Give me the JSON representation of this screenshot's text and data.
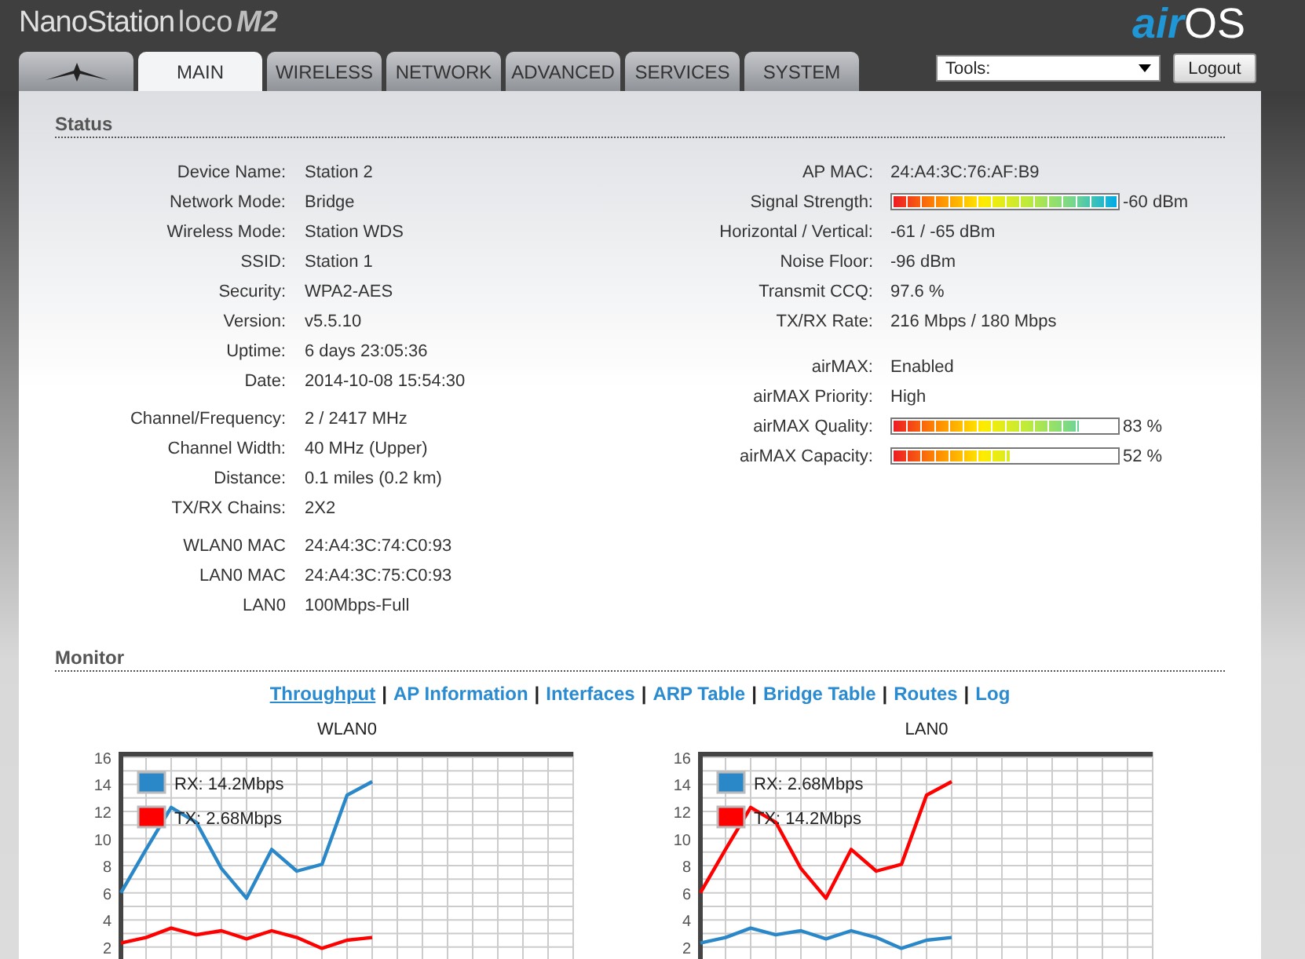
{
  "header": {
    "product": "NanoStation",
    "variant": "loco",
    "model": "M2",
    "brand_prefix": "air",
    "brand_suffix": "OS"
  },
  "tabs": [
    {
      "kind": "logo",
      "selected": false
    },
    {
      "kind": "text",
      "label": "MAIN",
      "selected": true
    },
    {
      "kind": "text",
      "label": "WIRELESS",
      "selected": false
    },
    {
      "kind": "text",
      "label": "NETWORK",
      "selected": false
    },
    {
      "kind": "text",
      "label": "ADVANCED",
      "selected": false
    },
    {
      "kind": "text",
      "label": "SERVICES",
      "selected": false
    },
    {
      "kind": "text",
      "label": "SYSTEM",
      "selected": false
    }
  ],
  "tools": {
    "value": "Tools:"
  },
  "logout": "Logout",
  "status": {
    "title": "Status",
    "left": [
      [
        {
          "label": "Device Name:",
          "value": "Station 2"
        },
        {
          "label": "Network Mode:",
          "value": "Bridge"
        },
        {
          "label": "Wireless Mode:",
          "value": "Station WDS"
        },
        {
          "label": "SSID:",
          "value": "Station 1"
        },
        {
          "label": "Security:",
          "value": "WPA2-AES"
        },
        {
          "label": "Version:",
          "value": "v5.5.10"
        },
        {
          "label": "Uptime:",
          "value": "6 days 23:05:36"
        },
        {
          "label": "Date:",
          "value": "2014-10-08 15:54:30"
        }
      ],
      [
        {
          "label": "Channel/Frequency:",
          "value": "2 / 2417 MHz"
        },
        {
          "label": "Channel Width:",
          "value": "40 MHz (Upper)"
        },
        {
          "label": "Distance:",
          "value": "0.1 miles (0.2 km)"
        },
        {
          "label": "TX/RX Chains:",
          "value": "2X2"
        }
      ],
      [
        {
          "label": "WLAN0 MAC",
          "value": "24:A4:3C:74:C0:93"
        },
        {
          "label": "LAN0 MAC",
          "value": "24:A4:3C:75:C0:93"
        },
        {
          "label": "LAN0",
          "value": "100Mbps-Full"
        }
      ]
    ],
    "right": [
      [
        {
          "kind": "text",
          "label": "AP MAC:",
          "value": "24:A4:3C:76:AF:B9"
        },
        {
          "kind": "meter",
          "label": "Signal Strength:",
          "level": 1.0,
          "value": "-60 dBm"
        },
        {
          "kind": "text",
          "label": "Horizontal / Vertical:",
          "value": "-61 / -65 dBm"
        },
        {
          "kind": "text",
          "label": "Noise Floor:",
          "value": "-96 dBm"
        },
        {
          "kind": "text",
          "label": "Transmit CCQ:",
          "value": "97.6 %"
        },
        {
          "kind": "text",
          "label": "TX/RX Rate:",
          "value": "216 Mbps / 180 Mbps"
        }
      ],
      [
        {
          "kind": "text",
          "label": "airMAX:",
          "value": "Enabled"
        },
        {
          "kind": "text",
          "label": "airMAX Priority:",
          "value": "High"
        },
        {
          "kind": "meter",
          "label": "airMAX Quality:",
          "level": 0.83,
          "value": "83 %"
        },
        {
          "kind": "meter",
          "label": "airMAX Capacity:",
          "level": 0.52,
          "value": "52 %"
        }
      ]
    ]
  },
  "monitor": {
    "title": "Monitor",
    "links": [
      {
        "label": "Throughput",
        "selected": true
      },
      {
        "label": "AP Information",
        "selected": false
      },
      {
        "label": "Interfaces",
        "selected": false
      },
      {
        "label": "ARP Table",
        "selected": false
      },
      {
        "label": "Bridge Table",
        "selected": false
      },
      {
        "label": "Routes",
        "selected": false
      },
      {
        "label": "Log",
        "selected": false
      }
    ],
    "separators": [
      "|",
      "|",
      "|",
      "|",
      "|",
      "|"
    ],
    "charts": [
      {
        "chart_data": {
          "type": "line",
          "title": "WLAN0",
          "categories": [
            null,
            null,
            null,
            null,
            null,
            null,
            null,
            null,
            null,
            null,
            null,
            null,
            null,
            null,
            null,
            null,
            null,
            null,
            null
          ],
          "ylim": [
            1,
            16.4
          ],
          "yticks": [
            2,
            4,
            6,
            8,
            10,
            12,
            14,
            16
          ],
          "grid": true,
          "legend": "upper left",
          "series": [
            {
              "name": "RX: 14.2Mbps",
              "color": "#2a88c8",
              "values": [
                6,
                9.2,
                12.3,
                11.2,
                7.8,
                5.6,
                9.2,
                7.6,
                8.1,
                13.2,
                14.2,
                null,
                null,
                null,
                null,
                null,
                null,
                null,
                null
              ]
            },
            {
              "name": "TX: 2.68Mbps",
              "color": "#ff0000",
              "values": [
                2.3,
                2.7,
                3.4,
                2.9,
                3.2,
                2.6,
                3.2,
                2.7,
                1.9,
                2.5,
                2.7,
                null,
                null,
                null,
                null,
                null,
                null,
                null,
                null
              ]
            }
          ]
        }
      },
      {
        "chart_data": {
          "type": "line",
          "title": "LAN0",
          "categories": [
            null,
            null,
            null,
            null,
            null,
            null,
            null,
            null,
            null,
            null,
            null,
            null,
            null,
            null,
            null,
            null,
            null,
            null,
            null
          ],
          "ylim": [
            1,
            16.4
          ],
          "yticks": [
            2,
            4,
            6,
            8,
            10,
            12,
            14,
            16
          ],
          "grid": true,
          "legend": "upper left",
          "series": [
            {
              "name": "RX: 2.68Mbps",
              "color": "#2a88c8",
              "values": [
                2.3,
                2.7,
                3.4,
                2.9,
                3.2,
                2.6,
                3.2,
                2.7,
                1.9,
                2.5,
                2.7,
                null,
                null,
                null,
                null,
                null,
                null,
                null,
                null
              ]
            },
            {
              "name": "TX: 14.2Mbps",
              "color": "#ff0000",
              "values": [
                6,
                9.2,
                12.3,
                11.2,
                7.8,
                5.6,
                9.2,
                7.6,
                8.1,
                13.2,
                14.2,
                null,
                null,
                null,
                null,
                null,
                null,
                null,
                null
              ]
            }
          ]
        }
      }
    ]
  }
}
